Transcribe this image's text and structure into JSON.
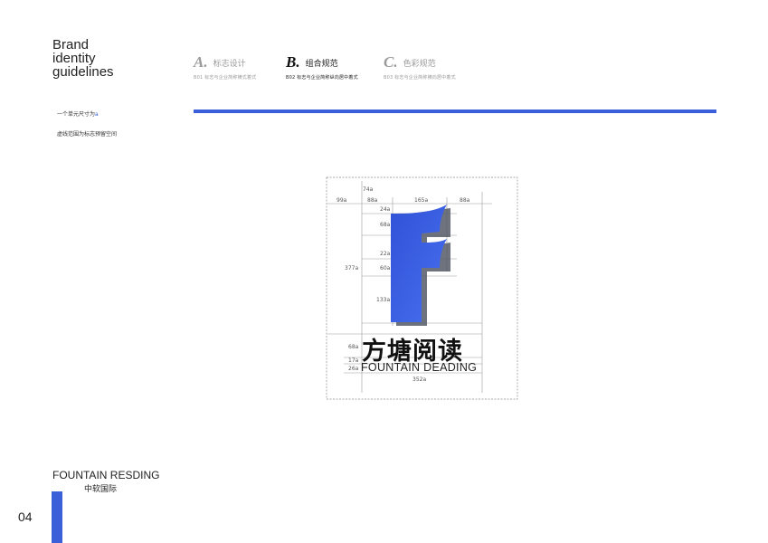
{
  "brand": {
    "title_lines": [
      "Brand",
      "identity",
      "guidelines"
    ]
  },
  "tabs": [
    {
      "letter": "A.",
      "label": "标志设计",
      "sub": "B01  标志与企业简称横式着式",
      "state": "dim"
    },
    {
      "letter": "B.",
      "label": "组合规范",
      "sub": "B02  标志与企业简称纵向居中着式",
      "state": "active"
    },
    {
      "letter": "C.",
      "label": "色彩规范",
      "sub": "B03  标志与企业简称横向居中着式",
      "state": "dim"
    }
  ],
  "notes": {
    "unit": "一个单元尺寸为",
    "unit_mark": "a",
    "clearspace": "虚线范围为标志预留空间"
  },
  "dimensions": {
    "top_74": "74a",
    "left_99": "99a",
    "col_88_left": "88a",
    "col_165": "165a",
    "col_88_right": "88a",
    "r_24": "24a",
    "r_68": "68a",
    "r_22": "22a",
    "r_60": "60a",
    "r_133": "133a",
    "total_377": "377a",
    "cn_68": "68a",
    "gap_17": "17a",
    "en_26": "26a",
    "width_352": "352a"
  },
  "logo": {
    "chinese": "方塘阅读",
    "english": "FOUNTAIN DEADING"
  },
  "footer": {
    "company_en": "FOUNTAIN RESDING",
    "company_cn": "中软国际",
    "page_number": "04"
  },
  "colors": {
    "accent": "#3a5fd9",
    "logo_gradient_start": "#2f52d6",
    "logo_gradient_end": "#4a6ff0"
  }
}
